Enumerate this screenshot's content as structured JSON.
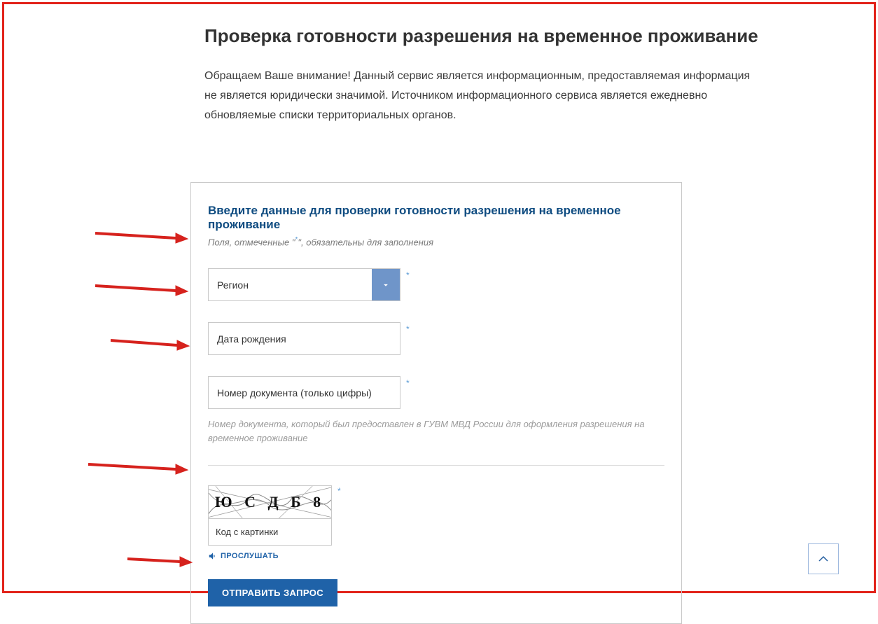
{
  "page": {
    "title": "Проверка готовности разрешения на временное проживание",
    "intro": "Обращаем Ваше внимание! Данный сервис является информационным, предоставляемая информация не является юридически значимой. Источником информационного сервиса является ежедневно обновляемые списки территориальных органов."
  },
  "form": {
    "heading": "Введите данные для проверки готовности разрешения на временное проживание",
    "required_prefix": "Поля, отмеченные \"",
    "required_star": "*",
    "required_suffix": "\", обязательны для заполнения",
    "region": {
      "placeholder": "Регион"
    },
    "dob": {
      "placeholder": "Дата рождения"
    },
    "docnum": {
      "placeholder": "Номер документа (только цифры)",
      "hint": "Номер документа, который был предоставлен в ГУВМ МВД России для оформления разрешения на временное проживание"
    },
    "captcha": {
      "chars": "Ю С Д Б 8",
      "input_placeholder": "Код с картинки",
      "listen": "ПРОСЛУШАТЬ"
    },
    "submit": "ОТПРАВИТЬ ЗАПРОС"
  }
}
